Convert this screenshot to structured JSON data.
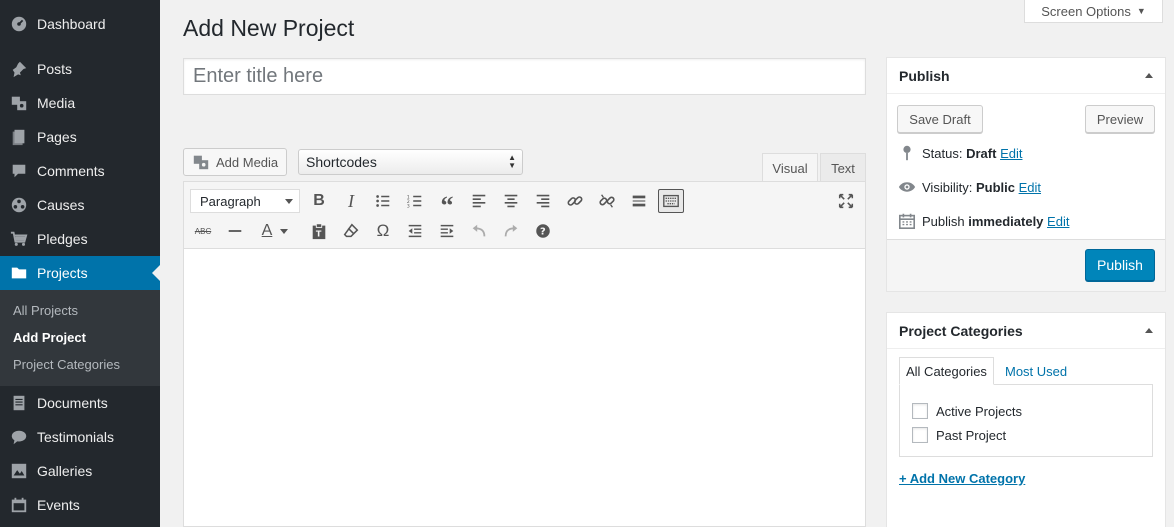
{
  "sidebar": {
    "items": [
      {
        "label": "Dashboard",
        "icon": "dashboard-icon"
      },
      {
        "label": "Posts",
        "icon": "pin-icon"
      },
      {
        "label": "Media",
        "icon": "media-icon"
      },
      {
        "label": "Pages",
        "icon": "pages-icon"
      },
      {
        "label": "Comments",
        "icon": "comment-icon"
      },
      {
        "label": "Causes",
        "icon": "causes-icon"
      },
      {
        "label": "Pledges",
        "icon": "cart-icon"
      },
      {
        "label": "Projects",
        "icon": "folder-icon"
      },
      {
        "label": "Documents",
        "icon": "document-icon"
      },
      {
        "label": "Testimonials",
        "icon": "testimonial-icon"
      },
      {
        "label": "Galleries",
        "icon": "gallery-icon"
      },
      {
        "label": "Events",
        "icon": "calendar-icon"
      }
    ],
    "submenu": [
      "All Projects",
      "Add Project",
      "Project Categories"
    ]
  },
  "header": {
    "screen_options": "Screen Options",
    "page_title": "Add New Project"
  },
  "title_field": {
    "placeholder": "Enter title here",
    "value": ""
  },
  "editor": {
    "add_media": "Add Media",
    "shortcodes": "Shortcodes",
    "tabs": [
      "Visual",
      "Text"
    ],
    "format_select": "Paragraph",
    "strike_label": "ABC",
    "special_char": "Ω",
    "text_color_letter": "A"
  },
  "publish": {
    "title": "Publish",
    "save_draft": "Save Draft",
    "preview": "Preview",
    "status_label": "Status:",
    "status_value": "Draft",
    "visibility_label": "Visibility:",
    "visibility_value": "Public",
    "publish_label": "Publish",
    "publish_value": "immediately",
    "edit": "Edit",
    "publish_button": "Publish"
  },
  "categories": {
    "title": "Project Categories",
    "tabs": [
      "All Categories",
      "Most Used"
    ],
    "items": [
      "Active Projects",
      "Past Project"
    ],
    "add_new": "+ Add New Category"
  },
  "colors": {
    "sidebar_bg": "#23282d",
    "active_menu": "#0073aa",
    "primary_button": "#0085ba",
    "link": "#0073aa"
  }
}
